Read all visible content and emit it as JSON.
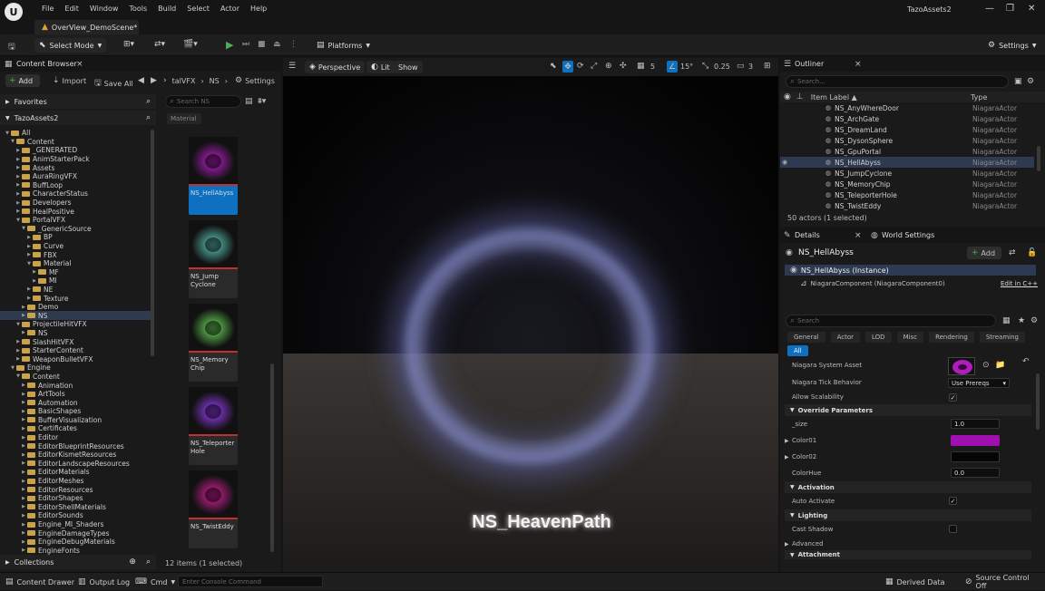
{
  "menubar": {
    "logo": "U",
    "items": [
      "File",
      "Edit",
      "Window",
      "Tools",
      "Build",
      "Select",
      "Actor",
      "Help"
    ],
    "project": "TazoAssets2",
    "window_buttons": [
      "—",
      "❐",
      "✕"
    ]
  },
  "level_tab": {
    "label": "OverView_DemoScene*",
    "close": "×"
  },
  "toolbar": {
    "select_mode": "Select Mode",
    "platforms": "Platforms",
    "settings": "Settings"
  },
  "content_browser": {
    "title": "Content Browser",
    "add": "Add",
    "import": "Import",
    "save_all": "Save All",
    "breadcrumb": [
      "talVFX",
      "NS"
    ],
    "settings": "Settings",
    "favorites": "Favorites",
    "root": "TazoAssets2",
    "search_placeholder": "Search NS",
    "filter_chip": "Material",
    "tree": [
      {
        "label": "All",
        "indent": 0,
        "open": true
      },
      {
        "label": "Content",
        "indent": 1,
        "open": true
      },
      {
        "label": "_GENERATED",
        "indent": 2
      },
      {
        "label": "AnimStarterPack",
        "indent": 2
      },
      {
        "label": "Assets",
        "indent": 2
      },
      {
        "label": "AuraRingVFX",
        "indent": 2
      },
      {
        "label": "BuffLoop",
        "indent": 2
      },
      {
        "label": "CharacterStatus",
        "indent": 2
      },
      {
        "label": "Developers",
        "indent": 2
      },
      {
        "label": "HealPositive",
        "indent": 2
      },
      {
        "label": "PortalVFX",
        "indent": 2,
        "open": true
      },
      {
        "label": "_GenericSource",
        "indent": 3,
        "open": true
      },
      {
        "label": "BP",
        "indent": 4
      },
      {
        "label": "Curve",
        "indent": 4
      },
      {
        "label": "FBX",
        "indent": 4
      },
      {
        "label": "Material",
        "indent": 4,
        "open": true
      },
      {
        "label": "MF",
        "indent": 5
      },
      {
        "label": "MI",
        "indent": 5
      },
      {
        "label": "NE",
        "indent": 4
      },
      {
        "label": "Texture",
        "indent": 4
      },
      {
        "label": "Demo",
        "indent": 3
      },
      {
        "label": "NS",
        "indent": 3,
        "selected": true
      },
      {
        "label": "ProjectileHitVFX",
        "indent": 2,
        "open": true
      },
      {
        "label": "NS",
        "indent": 3
      },
      {
        "label": "SlashHitVFX",
        "indent": 2
      },
      {
        "label": "StarterContent",
        "indent": 2
      },
      {
        "label": "WeaponBulletVFX",
        "indent": 2
      },
      {
        "label": "Engine",
        "indent": 1,
        "open": true
      },
      {
        "label": "Content",
        "indent": 2,
        "open": true
      },
      {
        "label": "Animation",
        "indent": 3
      },
      {
        "label": "ArtTools",
        "indent": 3
      },
      {
        "label": "Automation",
        "indent": 3
      },
      {
        "label": "BasicShapes",
        "indent": 3
      },
      {
        "label": "BufferVisualization",
        "indent": 3
      },
      {
        "label": "Certificates",
        "indent": 3
      },
      {
        "label": "Editor",
        "indent": 3
      },
      {
        "label": "EditorBlueprintResources",
        "indent": 3
      },
      {
        "label": "EditorKismetResources",
        "indent": 3
      },
      {
        "label": "EditorLandscapeResources",
        "indent": 3
      },
      {
        "label": "EditorMaterials",
        "indent": 3
      },
      {
        "label": "EditorMeshes",
        "indent": 3
      },
      {
        "label": "EditorResources",
        "indent": 3
      },
      {
        "label": "EditorShapes",
        "indent": 3
      },
      {
        "label": "EditorShellMaterials",
        "indent": 3
      },
      {
        "label": "EditorSounds",
        "indent": 3
      },
      {
        "label": "Engine_MI_Shaders",
        "indent": 3
      },
      {
        "label": "EngineDamageTypes",
        "indent": 3
      },
      {
        "label": "EngineDebugMaterials",
        "indent": 3
      },
      {
        "label": "EngineFonts",
        "indent": 3
      }
    ],
    "assets": [
      {
        "line1": "NS_HellAbyss",
        "line2": "",
        "selected": true,
        "color": "#c020d0"
      },
      {
        "line1": "NS_Jump",
        "line2": "Cyclone",
        "color": "#60d0c0"
      },
      {
        "line1": "NS_Memory",
        "line2": "Chip",
        "color": "#70e060"
      },
      {
        "line1": "NS_Teleporter",
        "line2": "Hole",
        "color": "#a040ff"
      },
      {
        "line1": "NS_TwistEddy",
        "line2": "",
        "color": "#e020a0"
      }
    ],
    "item_count": "12 items (1 selected)",
    "collections": "Collections"
  },
  "viewport": {
    "perspective": "Perspective",
    "lit": "Lit",
    "show": "Show",
    "grid_snap": "5",
    "angle_snap": "15°",
    "scale_snap": "0.25",
    "camera_speed": "3",
    "overlay_title": "NS_HeavenPath"
  },
  "outliner": {
    "title": "Outliner",
    "search_placeholder": "Search...",
    "col_label": "Item Label ▲",
    "col_type": "Type",
    "rows": [
      {
        "label": "NS_AnyWhereDoor",
        "type": "NiagaraActor"
      },
      {
        "label": "NS_ArchGate",
        "type": "NiagaraActor"
      },
      {
        "label": "NS_DreamLand",
        "type": "NiagaraActor"
      },
      {
        "label": "NS_DysonSphere",
        "type": "NiagaraActor"
      },
      {
        "label": "NS_GpuPortal",
        "type": "NiagaraActor"
      },
      {
        "label": "NS_HellAbyss",
        "type": "NiagaraActor",
        "selected": true
      },
      {
        "label": "NS_JumpCyclone",
        "type": "NiagaraActor"
      },
      {
        "label": "NS_MemoryChip",
        "type": "NiagaraActor"
      },
      {
        "label": "NS_TeleporterHole",
        "type": "NiagaraActor"
      },
      {
        "label": "NS_TwistEddy",
        "type": "NiagaraActor"
      }
    ],
    "count": "50 actors (1 selected)"
  },
  "details": {
    "title": "Details",
    "world_settings": "World Settings",
    "actor_name": "NS_HellAbyss",
    "add": "Add",
    "instance": "NS_HellAbyss (Instance)",
    "component": "NiagaraComponent (NiagaraComponent0)",
    "edit_cpp": "Edit in C++",
    "search_placeholder": "Search",
    "tabs": [
      "General",
      "Actor",
      "LOD",
      "Misc",
      "Rendering",
      "Streaming"
    ],
    "tab_all": "All",
    "niagara_asset": "Niagara System Asset",
    "tick_behavior": "Niagara Tick Behavior",
    "tick_value": "Use Prereqs",
    "allow_scalability": "Allow Scalability",
    "override_params": "Override Parameters",
    "size_label": "_size",
    "size_value": "1.0",
    "color01": "Color01",
    "color01_hex": "#a010b0",
    "color02": "Color02",
    "color02_hex": "#050505",
    "colorhue": "ColorHue",
    "colorhue_value": "0.0",
    "activation": "Activation",
    "auto_activate": "Auto Activate",
    "lighting": "Lighting",
    "cast_shadow": "Cast Shadow",
    "advanced": "Advanced",
    "attachment": "Attachment"
  },
  "statusbar": {
    "content_drawer": "Content Drawer",
    "output_log": "Output Log",
    "cmd": "Cmd",
    "console_placeholder": "Enter Console Command",
    "derived_data": "Derived Data",
    "source_control": "Source Control Off"
  },
  "colors": {
    "accent": "#0e70c0",
    "play": "#4caf50",
    "folder": "#c9a24a"
  }
}
